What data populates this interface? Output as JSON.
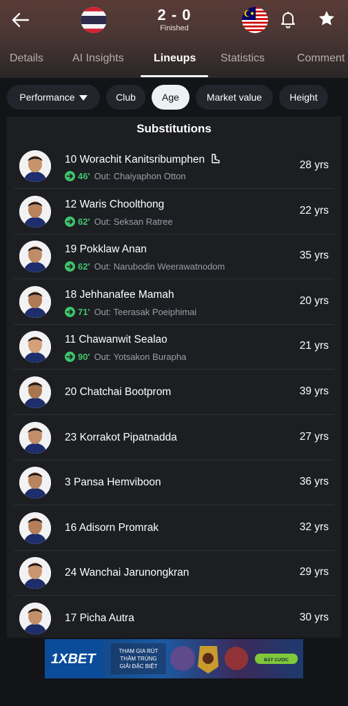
{
  "header": {
    "score": "2 - 0",
    "status": "Finished",
    "home_flag": "thailand-flag",
    "away_flag": "malaysia-flag"
  },
  "tabs": [
    "Details",
    "AI Insights",
    "Lineups",
    "Statistics",
    "Comment"
  ],
  "active_tab": "Lineups",
  "filters": {
    "dropdown": "Performance",
    "chips": [
      "Club",
      "Age",
      "Market value",
      "Height"
    ],
    "active": "Age"
  },
  "section_title": "Substitutions",
  "players": [
    {
      "number": "10",
      "name": "Worachit Kanitsribumphen",
      "minute": "46'",
      "out": "Out: Chaiyaphon Otton",
      "age": "28 yrs",
      "icon": "assist-boot-icon",
      "skin": "#c8936a"
    },
    {
      "number": "12",
      "name": "Waris Choolthong",
      "minute": "62'",
      "out": "Out: Seksan Ratree",
      "age": "22 yrs",
      "skin": "#b9835c"
    },
    {
      "number": "19",
      "name": "Pokklaw Anan",
      "minute": "62'",
      "out": "Out: Narubodin Weerawatnodom",
      "age": "35 yrs",
      "skin": "#c08b66"
    },
    {
      "number": "18",
      "name": "Jehhanafee Mamah",
      "minute": "71'",
      "out": "Out: Teerasak Poeiphimai",
      "age": "20 yrs",
      "skin": "#b07a55"
    },
    {
      "number": "11",
      "name": "Chawanwit Sealao",
      "minute": "90'",
      "out": "Out: Yotsakon Burapha",
      "age": "21 yrs",
      "skin": "#d3a07a"
    },
    {
      "number": "20",
      "name": "Chatchai Bootprom",
      "minute": "",
      "out": "",
      "age": "39 yrs",
      "skin": "#a9754f"
    },
    {
      "number": "23",
      "name": "Korrakot Pipatnadda",
      "minute": "",
      "out": "",
      "age": "27 yrs",
      "skin": "#c28e69"
    },
    {
      "number": "3",
      "name": "Pansa Hemviboon",
      "minute": "",
      "out": "",
      "age": "36 yrs",
      "skin": "#b88460"
    },
    {
      "number": "16",
      "name": "Adisorn Promrak",
      "minute": "",
      "out": "",
      "age": "32 yrs",
      "skin": "#b47f5a"
    },
    {
      "number": "24",
      "name": "Wanchai Jarunongkran",
      "minute": "",
      "out": "",
      "age": "29 yrs",
      "skin": "#c9966f"
    },
    {
      "number": "17",
      "name": "Picha Autra",
      "minute": "",
      "out": "",
      "age": "30 yrs",
      "skin": "#c4906b"
    }
  ],
  "ad": {
    "brand": "1XBET",
    "line1": "THAM GIA RÚT",
    "line2": "THĂM TRÚNG",
    "line3": "GIẢI ĐẶC BIỆT",
    "cta": "ĐẶT CƯỢC"
  },
  "colors": {
    "accent_green": "#3fc46b",
    "panel": "#1c1e22",
    "header": "#4a3634"
  }
}
